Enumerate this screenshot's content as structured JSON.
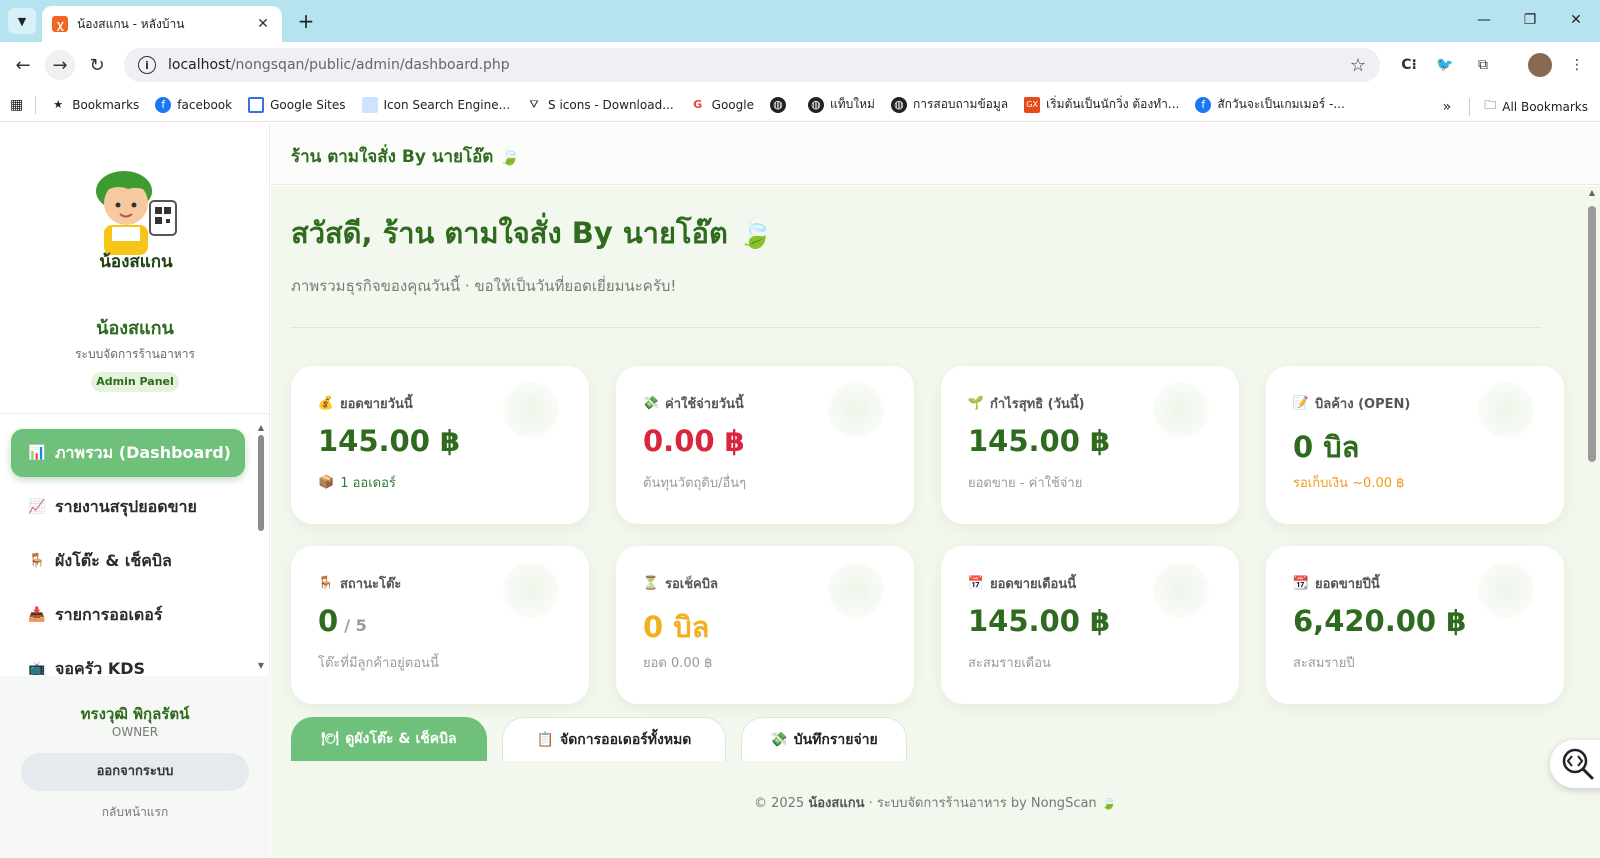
{
  "browser": {
    "tab_title": "น้องสแกน - หลังบ้าน",
    "url_host": "localhost",
    "url_path": "/nongsqan/public/admin/dashboard.php",
    "bookmarks": [
      {
        "label": "Bookmarks",
        "icon": "star-icon"
      },
      {
        "label": "facebook",
        "icon": "facebook-icon"
      },
      {
        "label": "Google Sites",
        "icon": "google-sites-icon"
      },
      {
        "label": "Icon Search Engine...",
        "icon": "icon-search-icon"
      },
      {
        "label": "S icons - Download...",
        "icon": "s-icons-icon"
      },
      {
        "label": "Google",
        "icon": "google-icon"
      },
      {
        "label": "",
        "icon": "globe-icon"
      },
      {
        "label": "แท็บใหม่",
        "icon": "globe-icon"
      },
      {
        "label": "การสอบถามข้อมูล",
        "icon": "globe-icon"
      },
      {
        "label": "เริ่มต้นเป็นนักวิ่ง ต้องทำ...",
        "icon": "runner-icon"
      },
      {
        "label": "สักวันจะเป็นเกมเมอร์ -...",
        "icon": "facebook-icon"
      }
    ],
    "all_bookmarks": "All Bookmarks"
  },
  "sidebar": {
    "brand": "น้องสแกน",
    "logo_text": "น้องสแกน",
    "subtitle": "ระบบจัดการร้านอาหาร",
    "badge": "Admin Panel",
    "nav": [
      {
        "label": "ภาพรวม (Dashboard)",
        "icon": "chart-icon",
        "active": true
      },
      {
        "label": "รายงานสรุปยอดขาย",
        "icon": "trend-chart-icon",
        "active": false
      },
      {
        "label": "ผังโต๊ะ & เช็คบิล",
        "icon": "chair-icon",
        "active": false
      },
      {
        "label": "รายการออเดอร์",
        "icon": "inbox-tray-icon",
        "active": false
      },
      {
        "label": "จอครัว KDS",
        "icon": "tv-icon",
        "active": false
      }
    ],
    "user_name": "ทรงวุฒิ พิกุลรัตน์",
    "user_role": "OWNER",
    "logout": "ออกจากระบบ",
    "home": "กลับหน้าแรก"
  },
  "topbar": {
    "title": "ร้าน ตามใจสั่ง By นายโอ๊ต 🍃"
  },
  "main": {
    "greeting": "สวัสดี, ร้าน ตามใจสั่ง By นายโอ๊ต 🍃",
    "subtitle": "ภาพรวมธุรกิจของคุณวันนี้ · ขอให้เป็นวันที่ยอดเยี่ยมนะครับ!",
    "cards": [
      {
        "icon": "money-bag-icon",
        "label": "ยอดขายวันนี้",
        "value": "145.00 ฿",
        "sub": "1 ออเดอร์",
        "sub_icon": "box-icon"
      },
      {
        "icon": "money-wings-icon",
        "label": "ค่าใช้จ่ายวันนี้",
        "value": "0.00 ฿",
        "sub": "ต้นทุนวัตถุดิบ/อื่นๆ"
      },
      {
        "icon": "seedling-icon",
        "label": "กำไรสุทธิ (วันนี้)",
        "value": "145.00 ฿",
        "sub": "ยอดขาย - ค่าใช้จ่าย"
      },
      {
        "icon": "memo-icon",
        "label": "บิลค้าง (OPEN)",
        "value": "0 บิล",
        "sub": "รอเก็บเงิน ~0.00 ฿"
      },
      {
        "icon": "chair-icon",
        "label": "สถานะโต๊ะ",
        "value": "0",
        "value_extra": "/ 5",
        "sub": "โต๊ะที่มีลูกค้าอยู่ตอนนี้"
      },
      {
        "icon": "hourglass-icon",
        "label": "รอเช็คบิล",
        "value": "0 บิล",
        "sub": "ยอด 0.00 ฿"
      },
      {
        "icon": "calendar-icon",
        "label": "ยอดขายเดือนนี้",
        "value": "145.00 ฿",
        "sub": "สะสมรายเดือน"
      },
      {
        "icon": "calendar-31-icon",
        "label": "ยอดขายปีนี้",
        "value": "6,420.00 ฿",
        "sub": "สะสมรายปี"
      }
    ],
    "actions": [
      {
        "label": "ดูผังโต๊ะ & เช็คบิล",
        "icon": "table-icon"
      },
      {
        "label": "จัดการออเดอร์ทั้งหมด",
        "icon": "clipboard-icon"
      },
      {
        "label": "บันทึกรายจ่าย",
        "icon": "money-wings-icon"
      }
    ],
    "footer_prefix": "© 2025",
    "footer_brand": "น้องสแกน",
    "footer_suffix": "·  ระบบจัดการร้านอาหาร by NongScan 🍃"
  },
  "colors": {
    "brand_green": "#2e6b1e",
    "active_nav": "#6fc07a",
    "expense_red": "#d7263d",
    "pending_yellow": "#f2b01e",
    "page_bg": "#f3f8ee"
  }
}
